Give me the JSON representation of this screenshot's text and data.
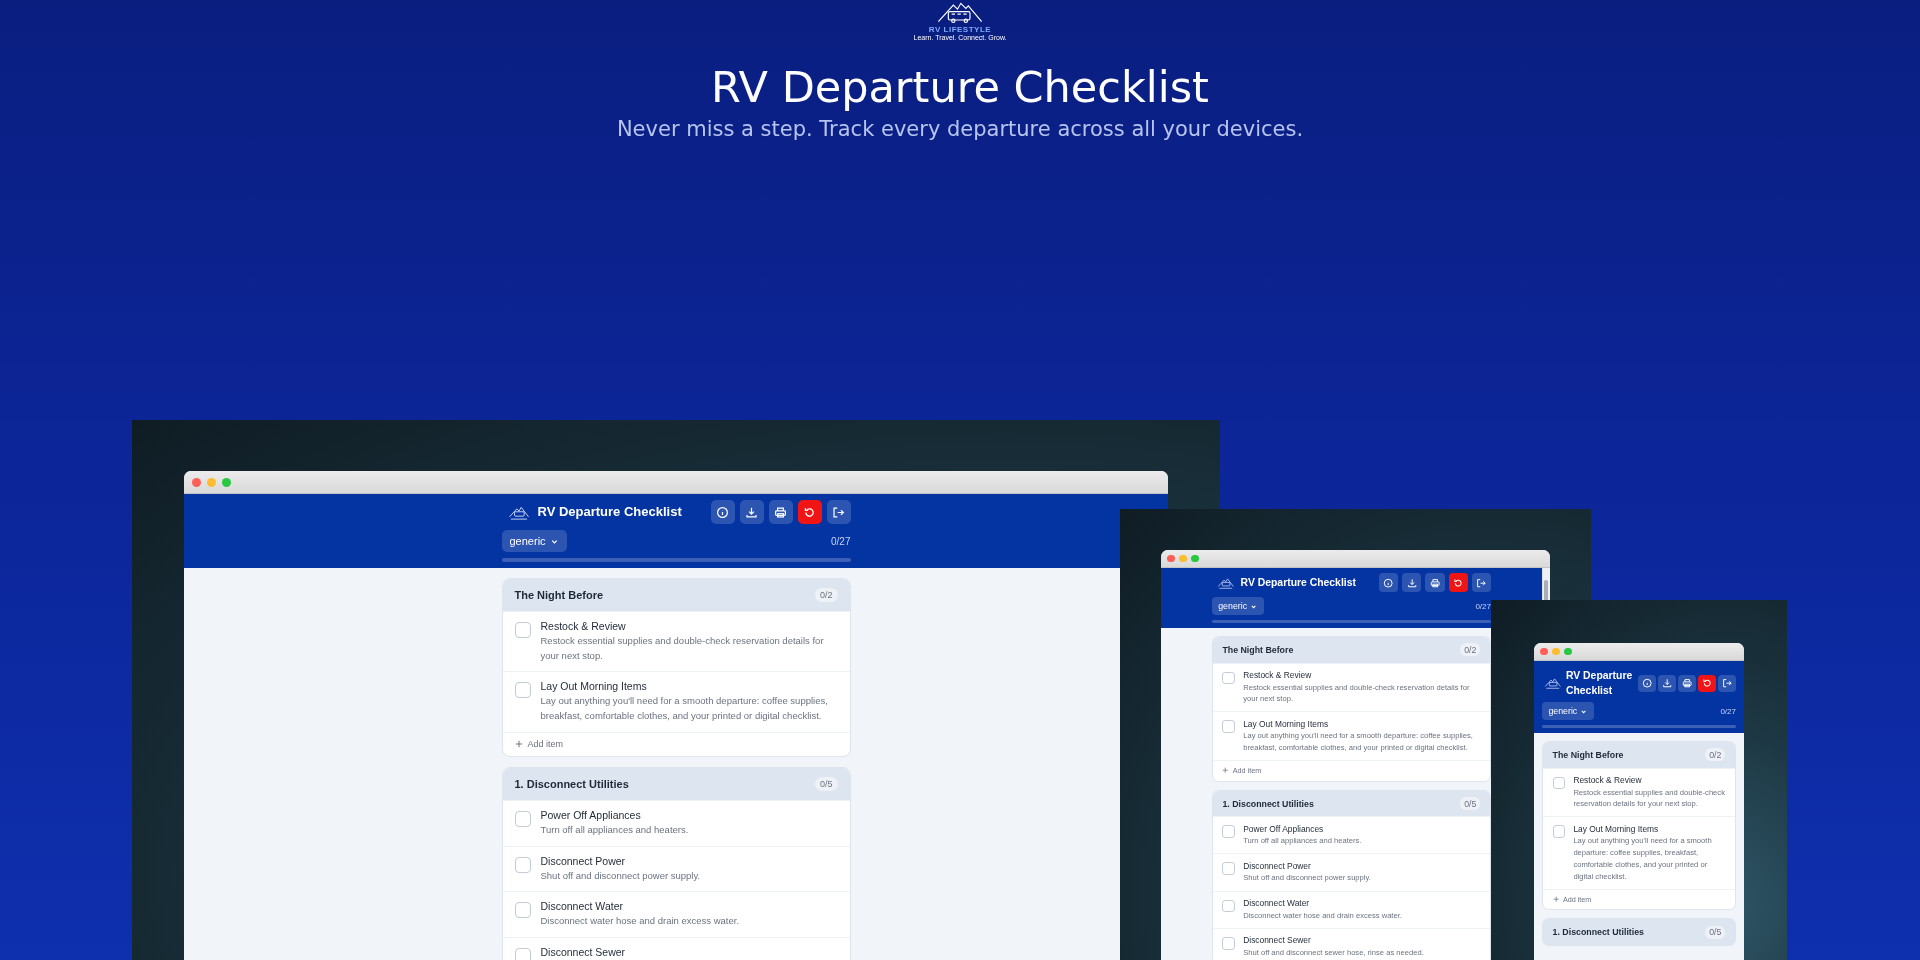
{
  "brand": {
    "name": "RV LIFESTYLE",
    "tagline": "Learn. Travel. Connect. Grow."
  },
  "hero": {
    "title": "RV Departure Checklist",
    "subtitle": "Never miss a step. Track every departure across all your devices."
  },
  "devices": [
    {
      "kind": "desktop",
      "app": {
        "title": "RV Departure Checklist",
        "template": "generic",
        "progress_text": "0/27",
        "level": 0,
        "sections": [
          {
            "title": "The Night Before",
            "count": "0/2",
            "add_label": "Add item",
            "items": [
              {
                "title": "Restock & Review",
                "description": "Restock essential supplies and double-check reservation details for your next stop.",
                "checked": false
              },
              {
                "title": "Lay Out Morning Items",
                "description": "Lay out anything you'll need for a smooth departure: coffee supplies, breakfast, comfortable clothes, and your printed or digital checklist.",
                "checked": false
              }
            ]
          },
          {
            "title": "1. Disconnect Utilities",
            "count": "0/5",
            "items": [
              {
                "title": "Power Off Appliances",
                "description": "Turn off all appliances and heaters.",
                "checked": false
              },
              {
                "title": "Disconnect Power",
                "description": "Shut off and disconnect power supply.",
                "checked": false
              },
              {
                "title": "Disconnect Water",
                "description": "Disconnect water hose and drain excess water.",
                "checked": false
              },
              {
                "title": "Disconnect Sewer",
                "checked": false
              }
            ]
          }
        ]
      }
    },
    {
      "kind": "tablet",
      "app": {
        "title": "RV Departure Checklist",
        "template": "generic",
        "progress_text": "0/27",
        "level": 0,
        "sections": [
          {
            "title": "The Night Before",
            "count": "0/2",
            "add_label": "Add item",
            "items": [
              {
                "title": "Restock & Review",
                "description": "Restock essential supplies and double-check reservation details for your next stop.",
                "checked": false
              },
              {
                "title": "Lay Out Morning Items",
                "description": "Lay out anything you'll need for a smooth departure: coffee supplies, breakfast, comfortable clothes, and your printed or digital checklist.",
                "checked": false
              }
            ]
          },
          {
            "title": "1. Disconnect Utilities",
            "count": "0/5",
            "items": [
              {
                "title": "Power Off Appliances",
                "description": "Turn off all appliances and heaters.",
                "checked": false
              },
              {
                "title": "Disconnect Power",
                "description": "Shut off and disconnect power supply.",
                "checked": false
              },
              {
                "title": "Disconnect Water",
                "description": "Disconnect water hose and drain excess water.",
                "checked": false
              },
              {
                "title": "Disconnect Sewer",
                "description": "Shut off and disconnect sewer hose, rinse as needed.",
                "checked": false
              }
            ]
          }
        ]
      }
    },
    {
      "kind": "phone",
      "app": {
        "title": "RV Departure Checklist",
        "template": "generic",
        "progress_text": "0/27",
        "level": 0,
        "sections": [
          {
            "title": "The Night Before",
            "count": "0/2",
            "add_label": "Add item",
            "items": [
              {
                "title": "Restock & Review",
                "description": "Restock essential supplies and double-check reservation details for your next stop.",
                "checked": false
              },
              {
                "title": "Lay Out Morning Items",
                "description": "Lay out anything you'll need for a smooth departure: coffee supplies, breakfast, comfortable clothes, and your printed or digital checklist.",
                "checked": false
              }
            ]
          },
          {
            "title": "1. Disconnect Utilities",
            "count": "0/5"
          }
        ]
      }
    }
  ]
}
